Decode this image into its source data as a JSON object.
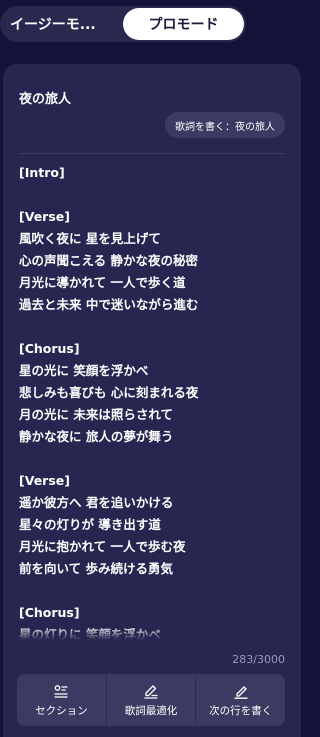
{
  "mode_toggle": {
    "easy_label": "イージーモ...",
    "pro_label": "プロモード"
  },
  "song": {
    "title": "夜の旅人",
    "prompt_chip": "歌詞を書く：夜の旅人"
  },
  "lyrics": {
    "lines": [
      "[Intro]",
      "",
      "[Verse]",
      "風吹く夜に 星を見上げて",
      "心の声聞こえる 静かな夜の秘密",
      "月光に導かれて 一人で歩く道",
      "過去と未来 中で迷いながら進む",
      "",
      "[Chorus]",
      "星の光に 笑顔を浮かべ",
      "悲しみも喜びも 心に刻まれる夜",
      "月の光に 未来は照らされて",
      "静かな夜に 旅人の夢が舞う",
      "",
      "[Verse]",
      "遥か彼方へ 君を追いかける",
      "星々の灯りが 導き出す道",
      "月光に抱かれて 一人で歩む夜",
      "前を向いて 歩み続ける勇気",
      "",
      "[Chorus]",
      "星の灯りに 笑顔を浮かべ"
    ]
  },
  "char_count": "283/3000",
  "toolbar": {
    "section": {
      "label": "セクション",
      "icon": "section-list-icon"
    },
    "optimize": {
      "label": "歌詞最適化",
      "icon": "edit-lines-icon"
    },
    "next_line": {
      "label": "次の行を書く",
      "icon": "pencil-icon"
    }
  }
}
